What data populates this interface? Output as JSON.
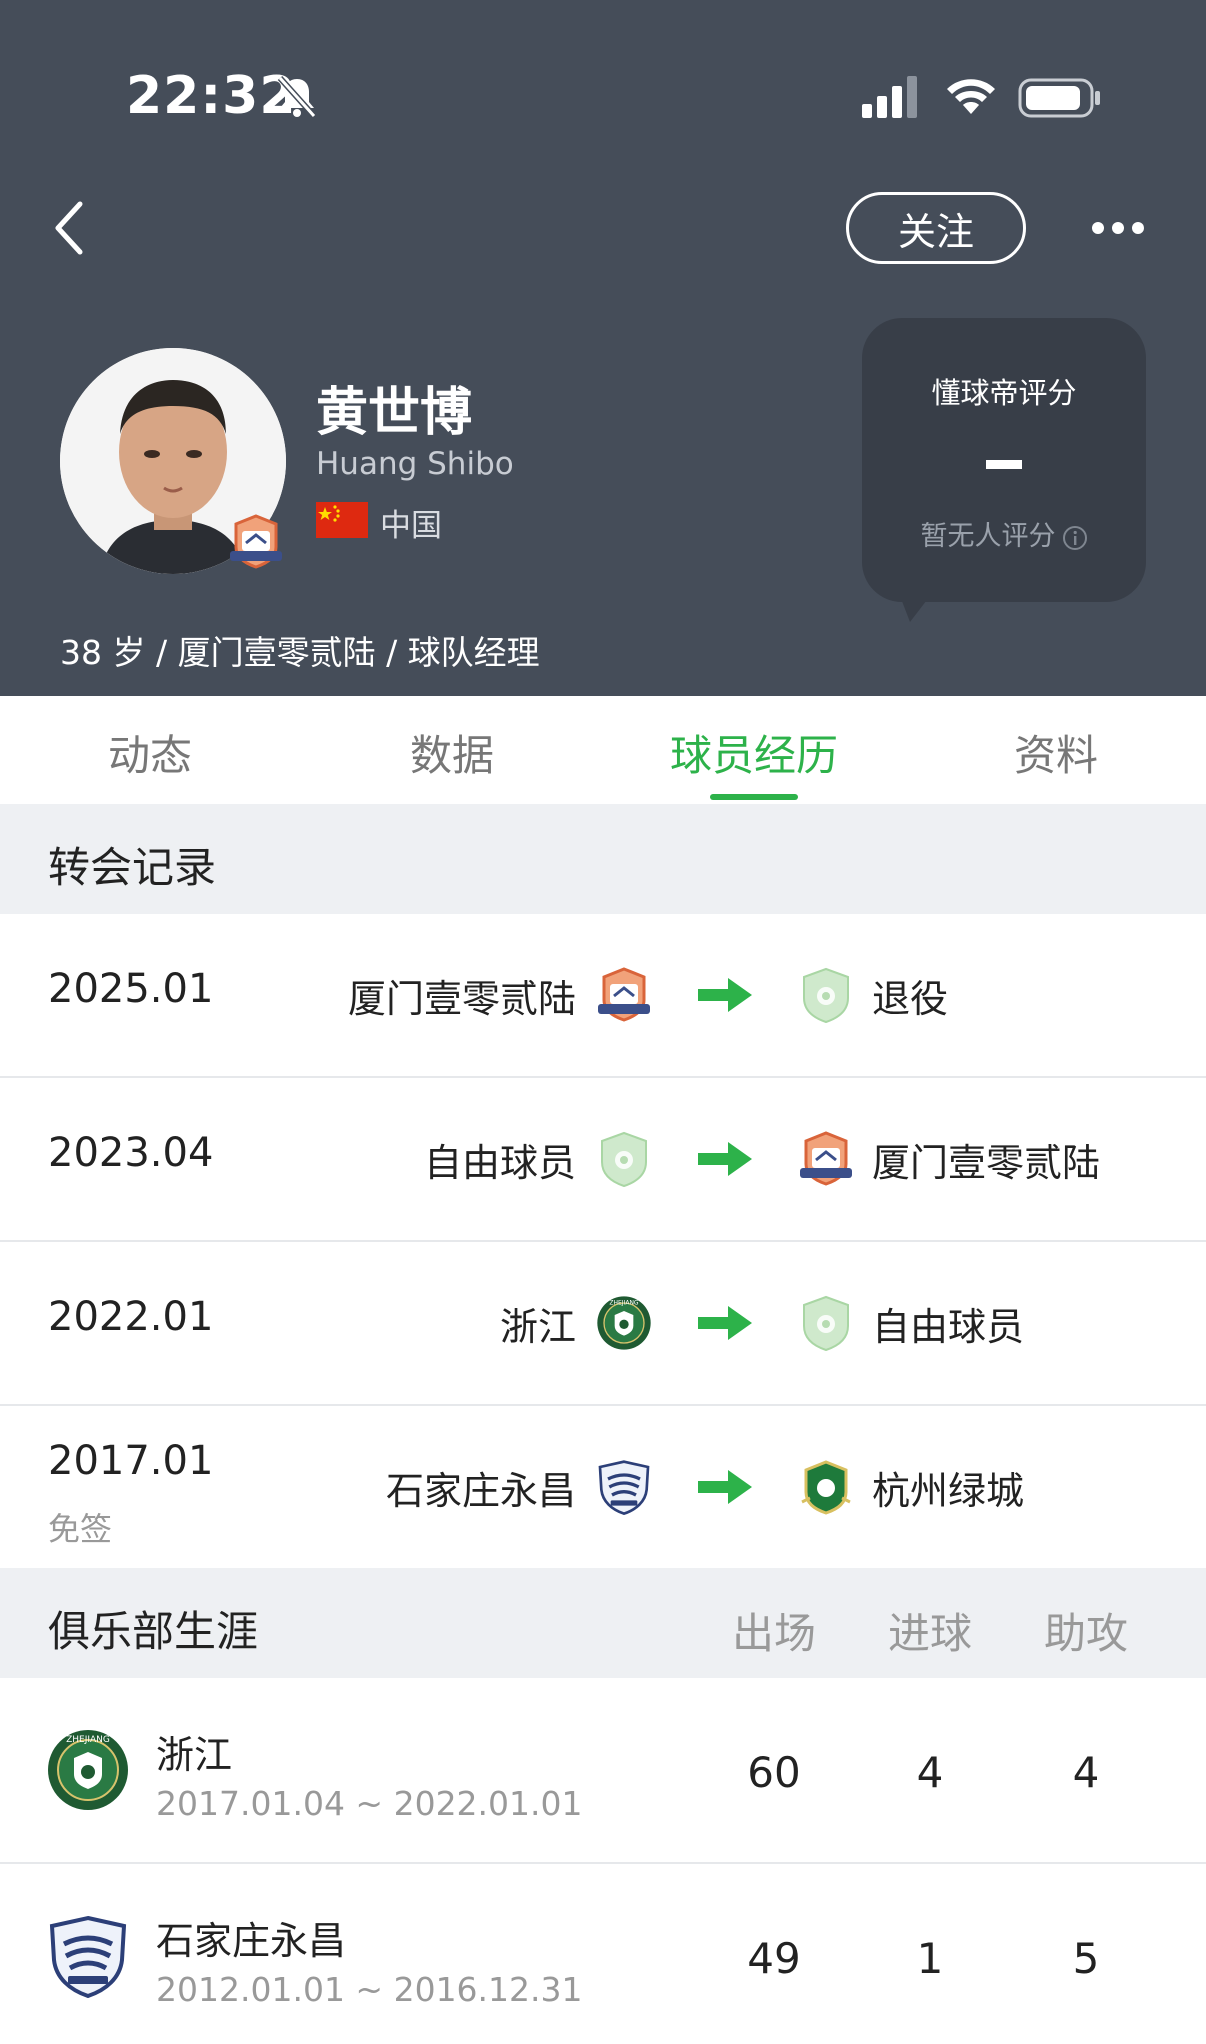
{
  "status_bar": {
    "time": "22:32"
  },
  "header": {
    "follow_label": "关注",
    "player": {
      "name_cn": "黄世博",
      "name_en": "Huang Shibo",
      "country": "中国",
      "meta": "38 岁 / 厦门壹零贰陆 / 球队经理"
    },
    "rating": {
      "title": "懂球帝评分",
      "value": "-",
      "note": "暂无人评分"
    }
  },
  "tabs": [
    {
      "label": "动态",
      "active": false
    },
    {
      "label": "数据",
      "active": false
    },
    {
      "label": "球员经历",
      "active": true
    },
    {
      "label": "资料",
      "active": false
    }
  ],
  "transfers": {
    "title": "转会记录",
    "rows": [
      {
        "date": "2025.01",
        "note": "",
        "from": "厦门壹零贰陆",
        "from_logo": "xiamen-logo",
        "to": "退役",
        "to_logo": "shield-placeholder-logo"
      },
      {
        "date": "2023.04",
        "note": "",
        "from": "自由球员",
        "from_logo": "shield-placeholder-logo",
        "to": "厦门壹零贰陆",
        "to_logo": "xiamen-logo"
      },
      {
        "date": "2022.01",
        "note": "",
        "from": "浙江",
        "from_logo": "zhejiang-logo",
        "to": "自由球员",
        "to_logo": "shield-placeholder-logo"
      },
      {
        "date": "2017.01",
        "note": "免签",
        "from": "石家庄永昌",
        "from_logo": "shijiazhuang-logo",
        "to": "杭州绿城",
        "to_logo": "hangzhou-logo"
      }
    ]
  },
  "career": {
    "title": "俱乐部生涯",
    "columns": [
      "出场",
      "进球",
      "助攻"
    ],
    "rows": [
      {
        "club": "浙江",
        "dates": "2017.01.04 ~ 2022.01.01",
        "apps": "60",
        "goals": "4",
        "assists": "4",
        "logo": "zhejiang-logo"
      },
      {
        "club": "石家庄永昌",
        "dates": "2012.01.01 ~ 2016.12.31",
        "apps": "49",
        "goals": "1",
        "assists": "5",
        "logo": "shijiazhuang-logo"
      }
    ]
  },
  "colors": {
    "header_bg": "#454d59",
    "accent_green": "#2db24a",
    "section_bg": "#eef0f3"
  }
}
